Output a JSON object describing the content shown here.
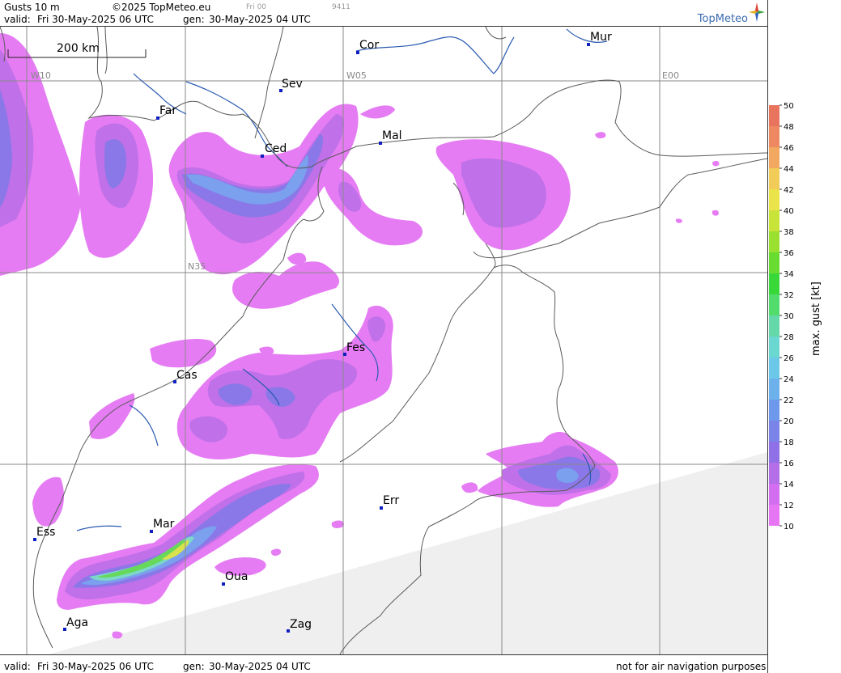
{
  "header": {
    "product": "Gusts 10 m",
    "copyright": "©2025 TopMeteo.eu",
    "run_small": "Fri 00",
    "code_small": "9411",
    "valid_label": "valid:",
    "valid_value": "Fri  30-May-2025  06 UTC",
    "gen_label": "gen:",
    "gen_value": "30-May-2025 04 UTC",
    "logo": "TopMeteo"
  },
  "footer": {
    "valid_label": "valid:",
    "valid_value": "Fri  30-May-2025  06 UTC",
    "gen_label": "gen:",
    "gen_value": "30-May-2025 04 UTC",
    "disclaimer": "not for air navigation purposes"
  },
  "map": {
    "scale_label": "200 km",
    "grid_labels": {
      "w10": "W10",
      "w05": "W05",
      "e00": "E00",
      "n35": "N35"
    },
    "cities": [
      {
        "name": "Cor"
      },
      {
        "name": "Mur"
      },
      {
        "name": "Sev"
      },
      {
        "name": "Far"
      },
      {
        "name": "Ced"
      },
      {
        "name": "Mal"
      },
      {
        "name": "Fes"
      },
      {
        "name": "Cas"
      },
      {
        "name": "Err"
      },
      {
        "name": "Mar"
      },
      {
        "name": "Ess"
      },
      {
        "name": "Oua"
      },
      {
        "name": "Aga"
      },
      {
        "name": "Zag"
      }
    ],
    "colors": {
      "land_line": "#5a5a5a",
      "river": "#2a5ab0",
      "grid": "#8a8a8a",
      "out_of_domain": "#efefef",
      "city_dot": "#1020c0"
    }
  },
  "legend": {
    "title": "max. gust [kt]",
    "ticks": [
      "50",
      "48",
      "46",
      "44",
      "42",
      "40",
      "38",
      "36",
      "34",
      "32",
      "30",
      "28",
      "26",
      "24",
      "22",
      "20",
      "18",
      "16",
      "14",
      "12",
      "10"
    ],
    "colors": [
      "#e8745e",
      "#ee8860",
      "#f2a860",
      "#f2cc58",
      "#eae44a",
      "#c8e438",
      "#9ae030",
      "#68dc30",
      "#38d838",
      "#52dc6c",
      "#64d8a8",
      "#6ad8d0",
      "#6cc8e8",
      "#6cb0ec",
      "#6e98ec",
      "#7a84e8",
      "#9070e6",
      "#b46ee8",
      "#d46ef0",
      "#e676f4"
    ]
  }
}
